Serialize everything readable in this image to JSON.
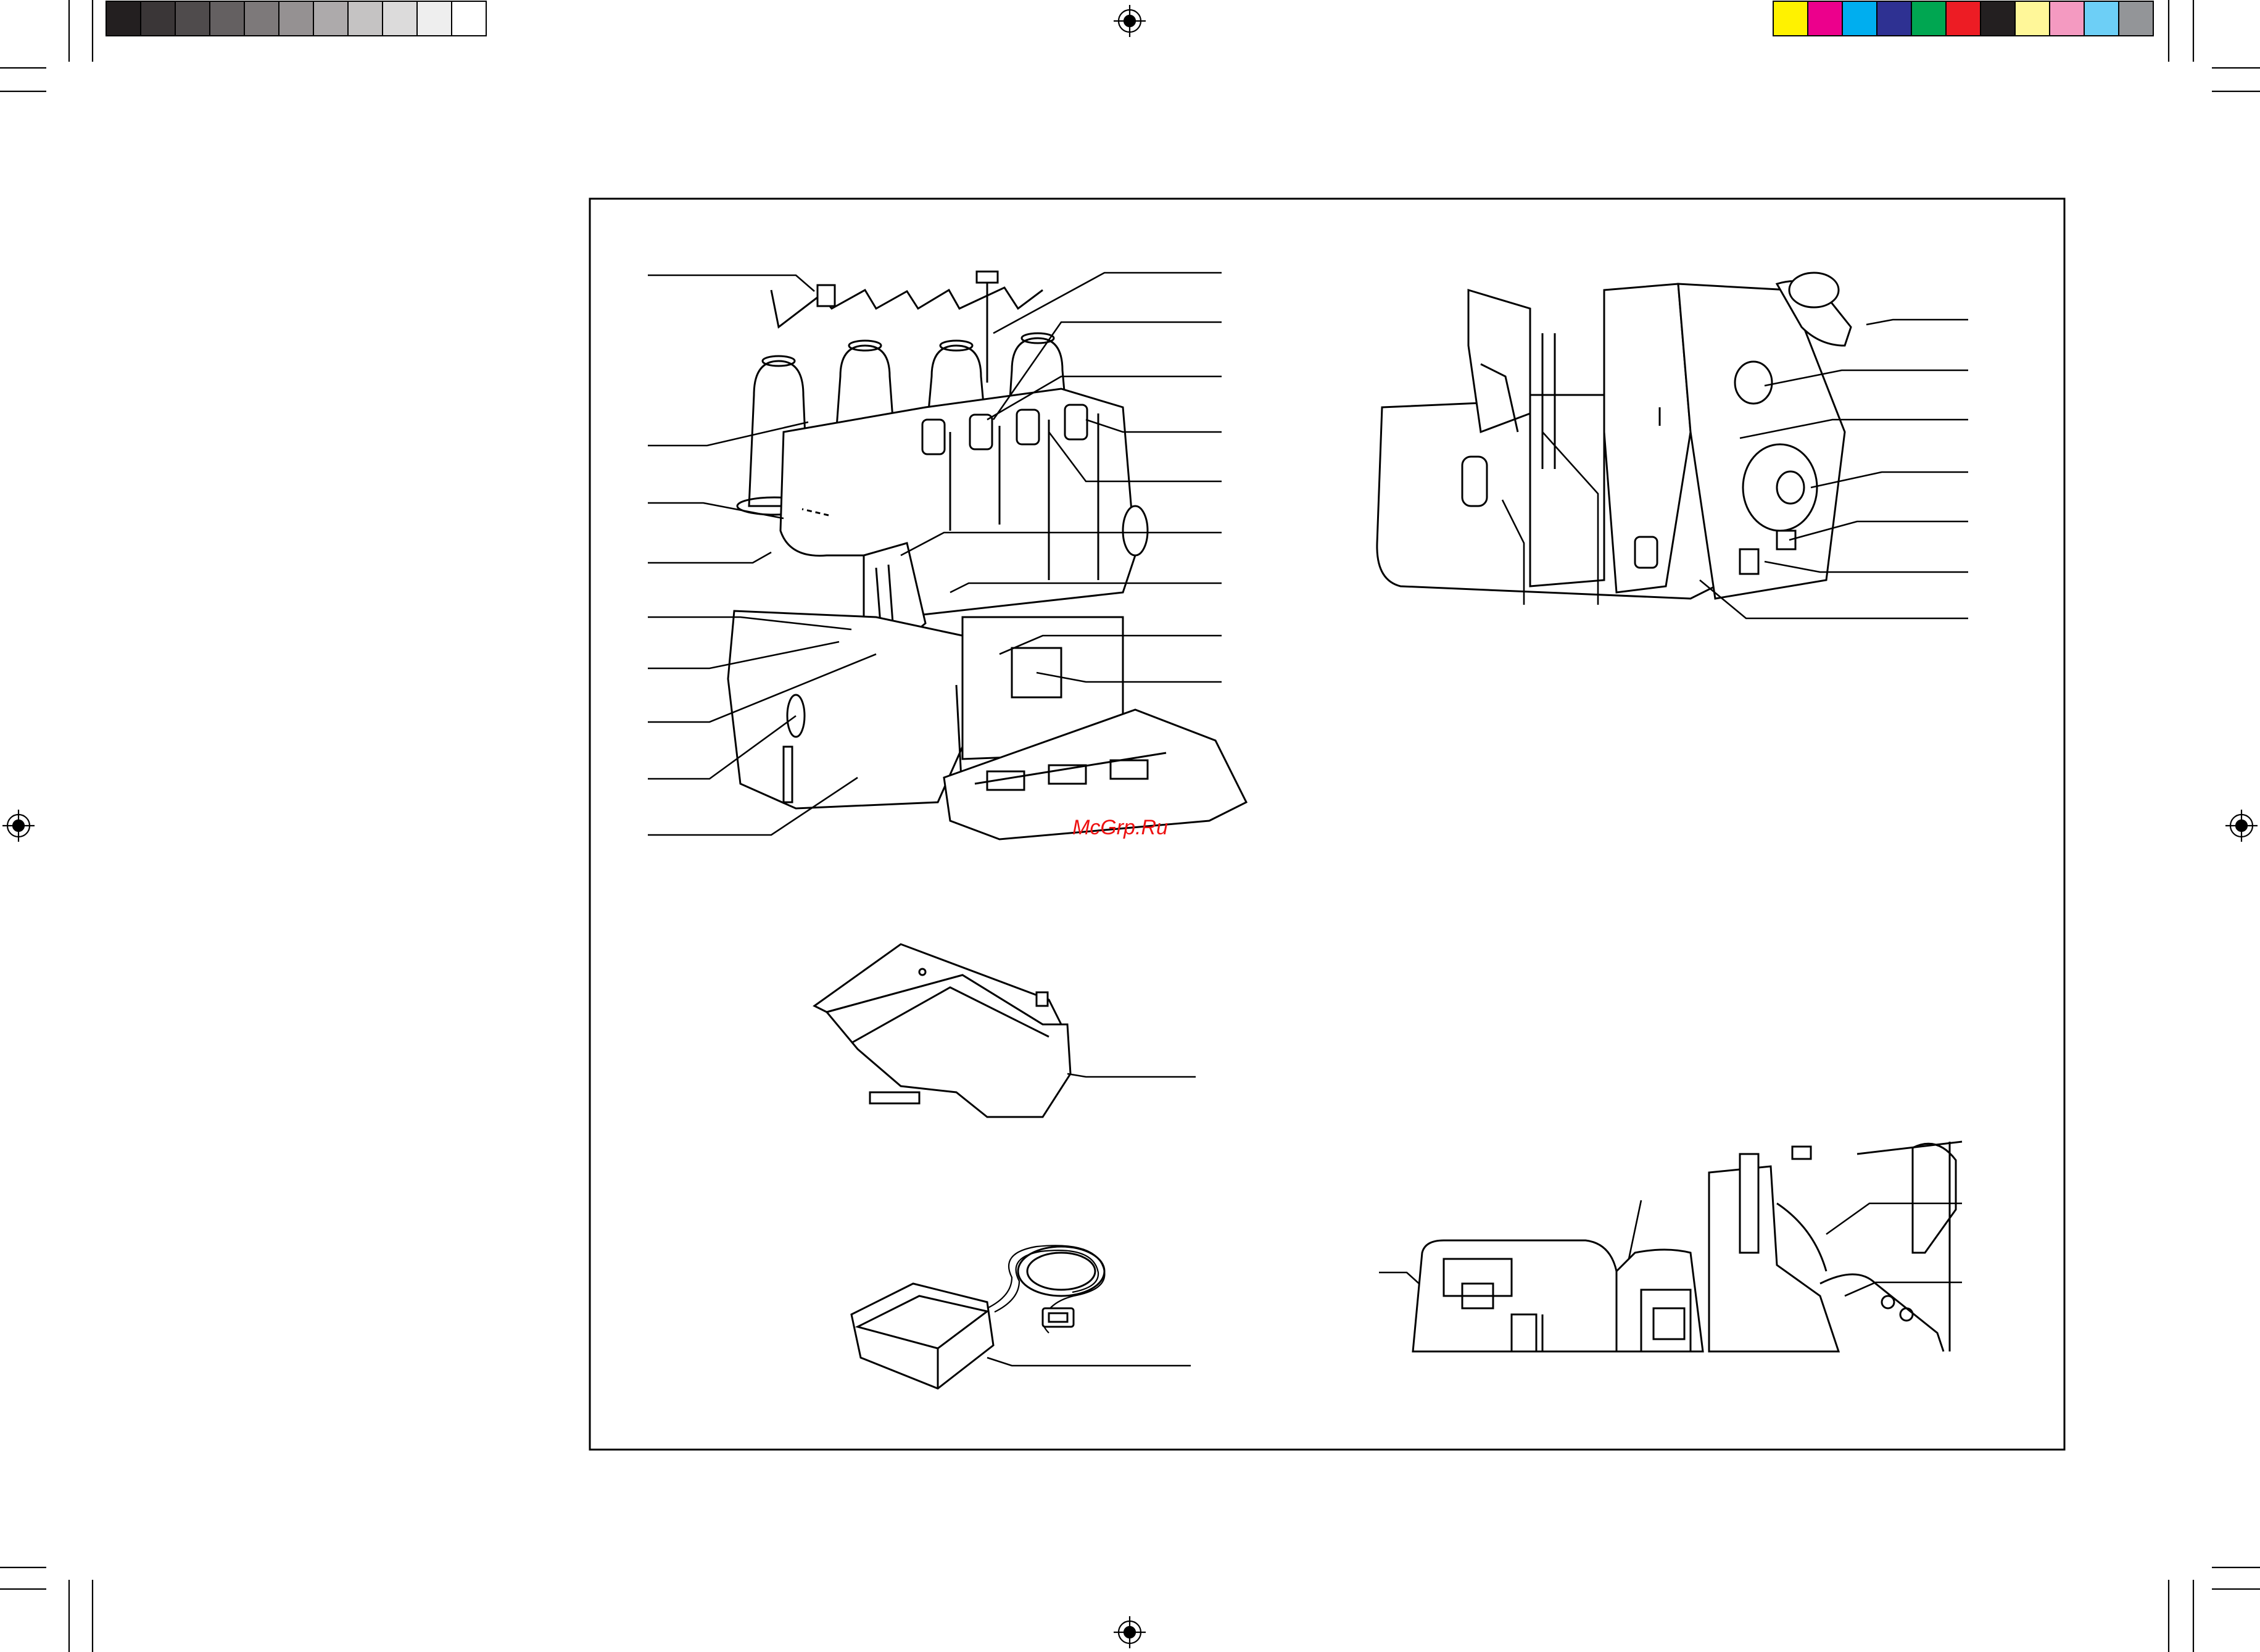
{
  "watermark": "McGrp.Ru",
  "color_bar": {
    "grays": [
      "#231f20",
      "#3a3637",
      "#4f4b4c",
      "#646061",
      "#7d797a",
      "#959192",
      "#adaaab",
      "#c5c3c3",
      "#dcdbdb",
      "#eeeeee",
      "#ffffff"
    ],
    "colors": [
      "#fff200",
      "#ec008c",
      "#00aeef",
      "#2e3192",
      "#00a651",
      "#ed1c24",
      "#231f20",
      "#fff799",
      "#f49ac1",
      "#6dcff6",
      "#939598"
    ]
  },
  "figures": [
    {
      "name": "serger-front-view"
    },
    {
      "name": "serger-right-view"
    },
    {
      "name": "trim-waste-tray"
    },
    {
      "name": "foot-controller"
    },
    {
      "name": "serger-looper-area"
    }
  ]
}
